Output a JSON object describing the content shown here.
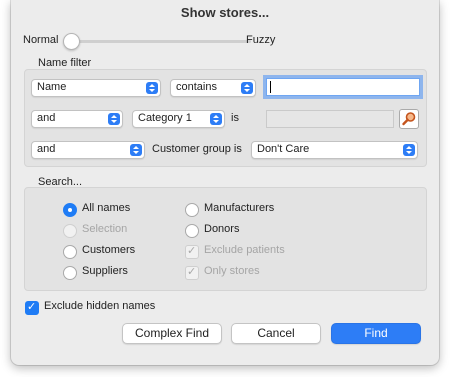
{
  "window": {
    "title": "Show stores..."
  },
  "match_slider": {
    "left_label": "Normal",
    "right_label": "Fuzzy"
  },
  "name_filter": {
    "heading": "Name filter",
    "row1": {
      "field": "Name",
      "operator": "contains",
      "value": ""
    },
    "row2": {
      "conjunction": "and",
      "category": "Category 1",
      "is_label": "is",
      "value": ""
    },
    "row3": {
      "conjunction": "and",
      "field_label": "Customer group is",
      "value": "Don't Care"
    }
  },
  "search": {
    "heading": "Search...",
    "radios": [
      {
        "label": "All names",
        "selected": true,
        "enabled": true
      },
      {
        "label": "Selection",
        "selected": false,
        "enabled": false
      },
      {
        "label": "Customers",
        "selected": false,
        "enabled": true
      },
      {
        "label": "Suppliers",
        "selected": false,
        "enabled": true
      },
      {
        "label": "Manufacturers",
        "selected": false,
        "enabled": true
      },
      {
        "label": "Donors",
        "selected": false,
        "enabled": true
      }
    ],
    "checks": [
      {
        "label": "Exclude patients",
        "checked": true,
        "enabled": false
      },
      {
        "label": "Only stores",
        "checked": true,
        "enabled": false
      }
    ]
  },
  "exclude_hidden": {
    "label": "Exclude hidden names",
    "checked": true
  },
  "buttons": {
    "complex_find": "Complex Find",
    "cancel": "Cancel",
    "find": "Find"
  },
  "icons": {
    "lookup": "magnifier-icon",
    "popup_arrow": "updown-chevron-icon",
    "checkmark": "checkmark-icon"
  },
  "colors": {
    "accent": "#2d7df6",
    "window_bg": "#ececec",
    "group_bg": "#e3e3e3"
  }
}
